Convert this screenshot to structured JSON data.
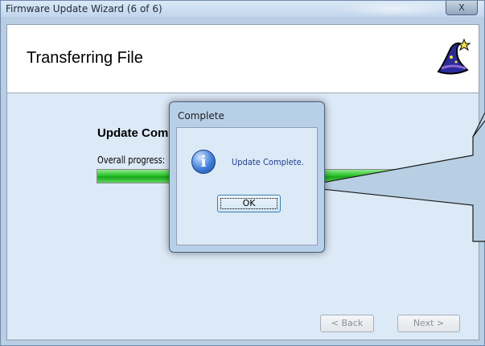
{
  "window": {
    "title": "Firmware Update Wizard (6 of 6)",
    "close_glyph": "X"
  },
  "header": {
    "title": "Transferring File",
    "icon": "wizard-hat-icon"
  },
  "main": {
    "status_text": "Update Comp",
    "progress_label": "Overall progress:",
    "progress_value": 1.0,
    "progress_color": "#2cc42c"
  },
  "buttons": {
    "back_label": "< Back",
    "next_label": "Next >"
  },
  "dialog": {
    "title": "Complete",
    "icon": "info-icon",
    "message": "Update Complete.",
    "ok_label": "OK"
  },
  "callout": {
    "fill": "#b8cfe3",
    "stroke": "#1a1a1a"
  }
}
